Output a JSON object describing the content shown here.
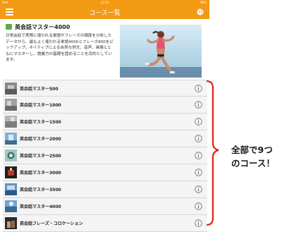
{
  "status_bar": {
    "left": "iPad",
    "time": "22:54",
    "right": "86%"
  },
  "nav": {
    "title": "コース一覧"
  },
  "intro": {
    "title": "英会話マスター4000",
    "text": "日常会話で実際に使われる単語やフレーズの頻度を分析したデータから、最もよく使われる単語4000とフレーズ800をピックアップ。ネイティブによる自然な例文、音声、画像とともにマスターし、語彙力の基礎を固めることを目的としています。"
  },
  "courses": [
    {
      "label": "英会話マスター500",
      "thumb": "gray-photo"
    },
    {
      "label": "英会話マスター1000",
      "thumb": "gray-photo"
    },
    {
      "label": "英会話マスター1500",
      "thumb": "gray-photo"
    },
    {
      "label": "英会話マスター2000",
      "thumb": "blue-photo"
    },
    {
      "label": "英会話マスター2500",
      "thumb": "teal-photo"
    },
    {
      "label": "英会話マスター3000",
      "thumb": "dark-photo"
    },
    {
      "label": "英会話マスター3500",
      "thumb": "blue-photo"
    },
    {
      "label": "英会話マスター4000",
      "thumb": "blue-photo"
    },
    {
      "label": "英会話フレーズ・コロケーション",
      "thumb": "dark-photo"
    }
  ],
  "annotation": {
    "line1": "全部で9つ",
    "line2": "のコース！"
  },
  "colors": {
    "accent": "#f39a14",
    "bracket": "#e2231a",
    "book": "#5ea94e"
  }
}
